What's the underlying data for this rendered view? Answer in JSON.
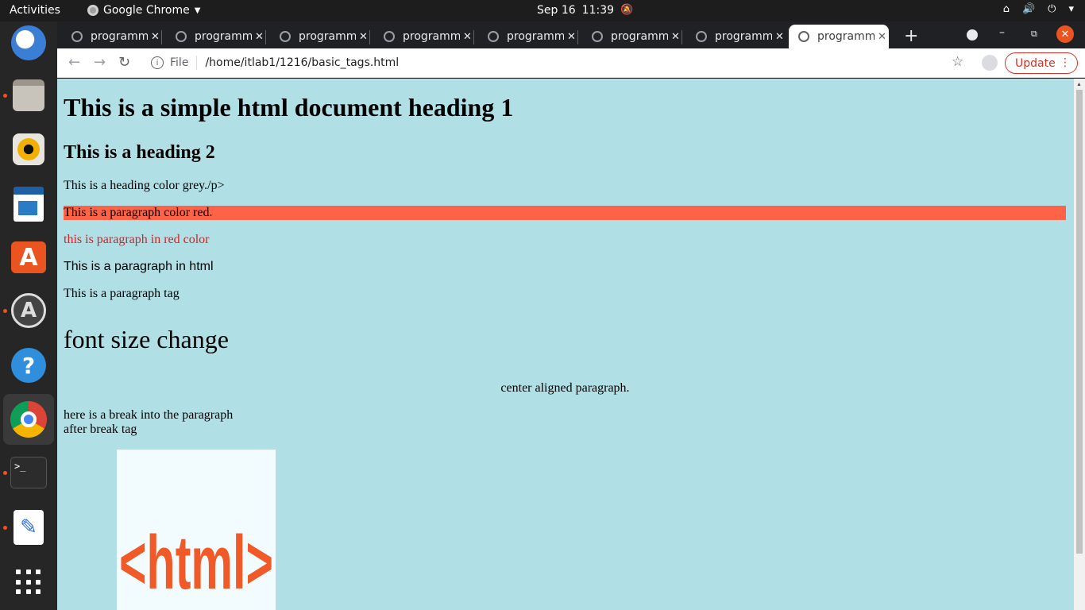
{
  "topbar": {
    "activities": "Activities",
    "app_name": "Google Chrome",
    "date": "Sep 16",
    "time": "11:39"
  },
  "dock": {
    "apps": [
      "thunderbird-icon",
      "files-icon",
      "rhythmbox-icon",
      "writer-icon",
      "software-icon",
      "updater-icon",
      "help-icon",
      "chrome-icon",
      "terminal-icon",
      "text-editor-icon",
      "show-apps-icon"
    ],
    "terminal_glyph": ">_"
  },
  "browser": {
    "tabs": [
      {
        "title": "programming"
      },
      {
        "title": "programming"
      },
      {
        "title": "programming"
      },
      {
        "title": "programming"
      },
      {
        "title": "programming"
      },
      {
        "title": "programming"
      },
      {
        "title": "programming"
      },
      {
        "title": "programming"
      }
    ],
    "active_tab": 7,
    "address": {
      "scheme_label": "File",
      "url": "/home/itlab1/1216/basic_tags.html"
    },
    "update_label": "Update"
  },
  "page": {
    "background": "#b0e0e6",
    "heading1": "This is a simple html document heading 1",
    "heading2": "This is a heading 2",
    "grey_para": "This is a heading color grey./p>",
    "red_bg_para": "This is a paragraph color red.",
    "red_text_para": "this is paragraph in red color",
    "html_para": "This is a paragraph in html",
    "tag_para": "This is a paragraph tag",
    "font_size_para": "font size change",
    "center_para": "center aligned paragraph.",
    "break_line1": "here is a break into the paragraph",
    "break_line2": "after break tag",
    "logo_text": "<html>"
  },
  "colors": {
    "red_bg": "#ff6347",
    "red_text": "#d22323",
    "logo": "#f05a28",
    "update": "#d93025"
  }
}
